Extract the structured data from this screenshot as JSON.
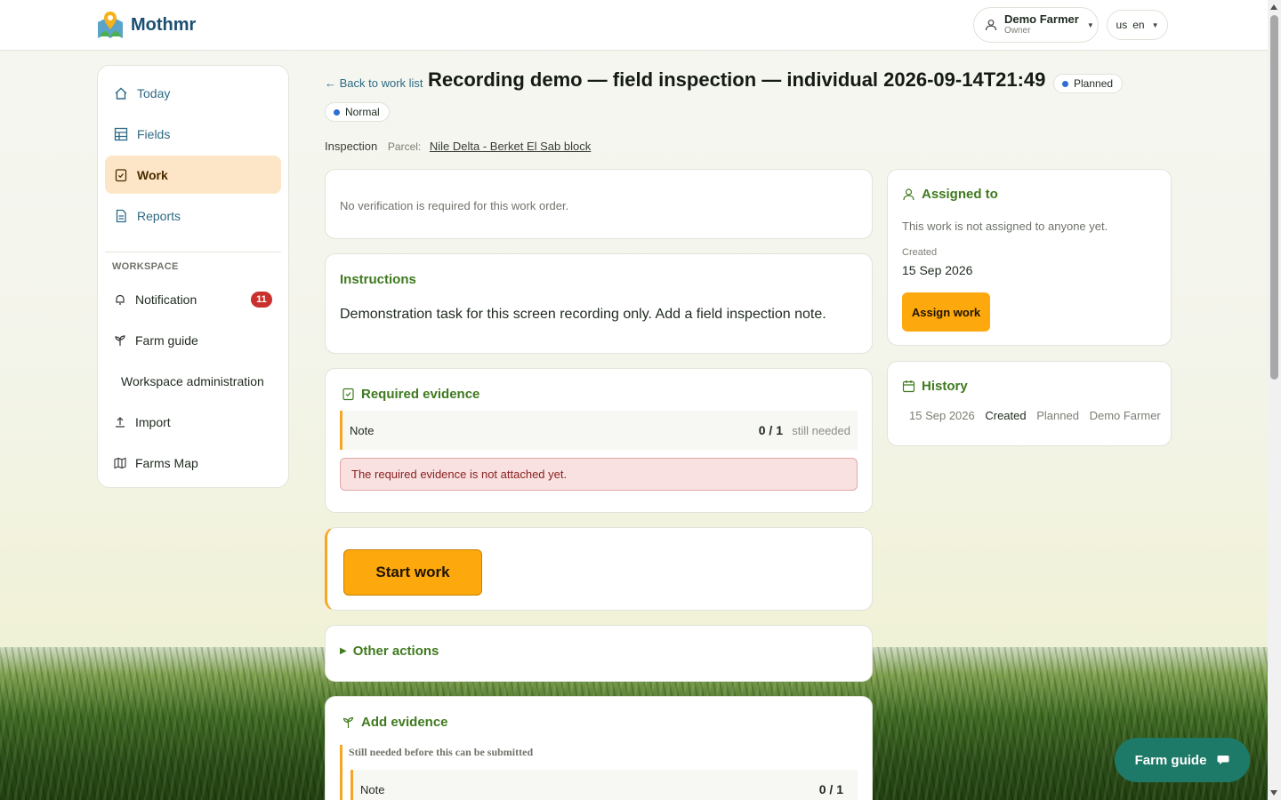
{
  "app": {
    "name": "Mothmr"
  },
  "user": {
    "name": "Demo Farmer",
    "role": "Owner"
  },
  "language": {
    "flag": "us",
    "code": "en"
  },
  "sidebar": {
    "items": [
      {
        "label": "Today",
        "icon": "home-icon"
      },
      {
        "label": "Fields",
        "icon": "table-icon"
      },
      {
        "label": "Work",
        "icon": "clipboard-check-icon",
        "active": true
      },
      {
        "label": "Reports",
        "icon": "document-icon"
      }
    ],
    "workspace_heading": "WORKSPACE",
    "workspace_items": [
      {
        "label": "Notification",
        "icon": "bell-icon",
        "badge": "11"
      },
      {
        "label": "Farm guide",
        "icon": "sprout-icon"
      },
      {
        "label": "Workspace administration",
        "icon": ""
      },
      {
        "label": "Import",
        "icon": "upload-icon"
      },
      {
        "label": "Farms Map",
        "icon": "map-icon"
      }
    ]
  },
  "header": {
    "back_label": "← Back to work list",
    "title": "Recording demo — field inspection — individual 2026-09-14T21:49",
    "status": "Planned",
    "priority": "Normal",
    "type": "Inspection",
    "parcel_label": "Parcel:",
    "parcel_name": "Nile Delta - Berket El Sab block"
  },
  "verification": {
    "text": "No verification is required for this work order."
  },
  "instructions": {
    "title": "Instructions",
    "text": "Demonstration task for this screen recording only. Add a field inspection note."
  },
  "required_evidence": {
    "title": "Required evidence",
    "item": "Note",
    "count": "0 / 1",
    "need": "still needed",
    "alert": "The required evidence is not attached yet."
  },
  "start": {
    "label": "Start work"
  },
  "other_actions": {
    "label": "Other actions"
  },
  "add_evidence": {
    "title": "Add evidence",
    "subtitle": "Still needed before this can be submitted",
    "item": "Note",
    "count": "0 / 1"
  },
  "assigned": {
    "title": "Assigned to",
    "text": "This work is not assigned to anyone yet.",
    "created_label": "Created",
    "created_date": "15 Sep 2026",
    "button": "Assign work"
  },
  "history": {
    "title": "History",
    "date": "15 Sep 2026",
    "event": "Created",
    "state": "Planned",
    "actor": "Demo Farmer"
  },
  "fab": {
    "label": "Farm guide"
  },
  "colors": {
    "accent": "#fda80d",
    "brand": "#1a4f72",
    "green": "#3f7a1e",
    "link": "#2d6a85",
    "fab": "#1e7a68"
  }
}
